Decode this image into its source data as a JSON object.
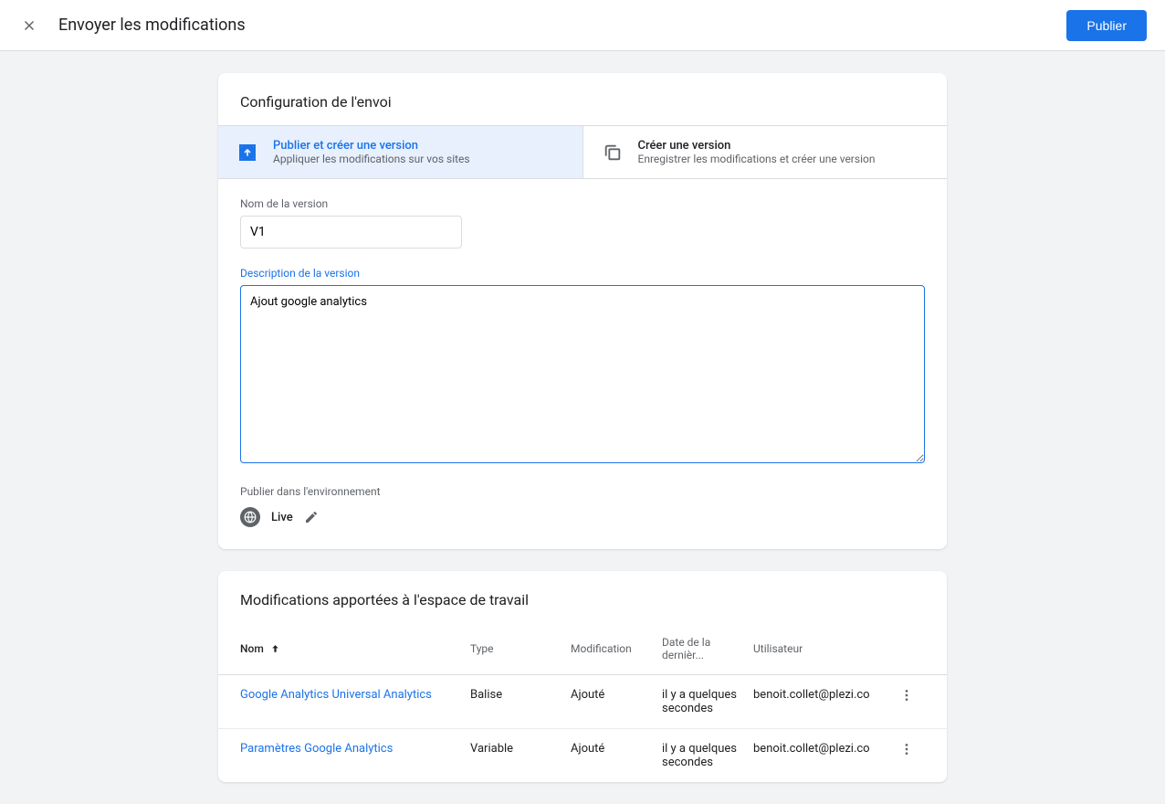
{
  "header": {
    "title": "Envoyer les modifications",
    "publish_button": "Publier"
  },
  "config": {
    "section_title": "Configuration de l'envoi",
    "tabs": [
      {
        "title": "Publier et créer une version",
        "subtitle": "Appliquer les modifications sur vos sites"
      },
      {
        "title": "Créer une version",
        "subtitle": "Enregistrer les modifications et créer une version"
      }
    ],
    "version_name_label": "Nom de la version",
    "version_name_value": "V1",
    "version_desc_label": "Description de la version",
    "version_desc_value": "Ajout google analytics",
    "env_label": "Publier dans l'environnement",
    "env_value": "Live"
  },
  "changes": {
    "section_title": "Modifications apportées à l'espace de travail",
    "columns": {
      "name": "Nom",
      "type": "Type",
      "modification": "Modification",
      "date": "Date de la dernièr...",
      "user": "Utilisateur"
    },
    "rows": [
      {
        "name": "Google Analytics Universal Analytics",
        "type": "Balise",
        "modification": "Ajouté",
        "date": "il y a quelques secondes",
        "user": "benoit.collet@plezi.co"
      },
      {
        "name": "Paramètres Google Analytics",
        "type": "Variable",
        "modification": "Ajouté",
        "date": "il y a quelques secondes",
        "user": "benoit.collet@plezi.co"
      }
    ]
  }
}
